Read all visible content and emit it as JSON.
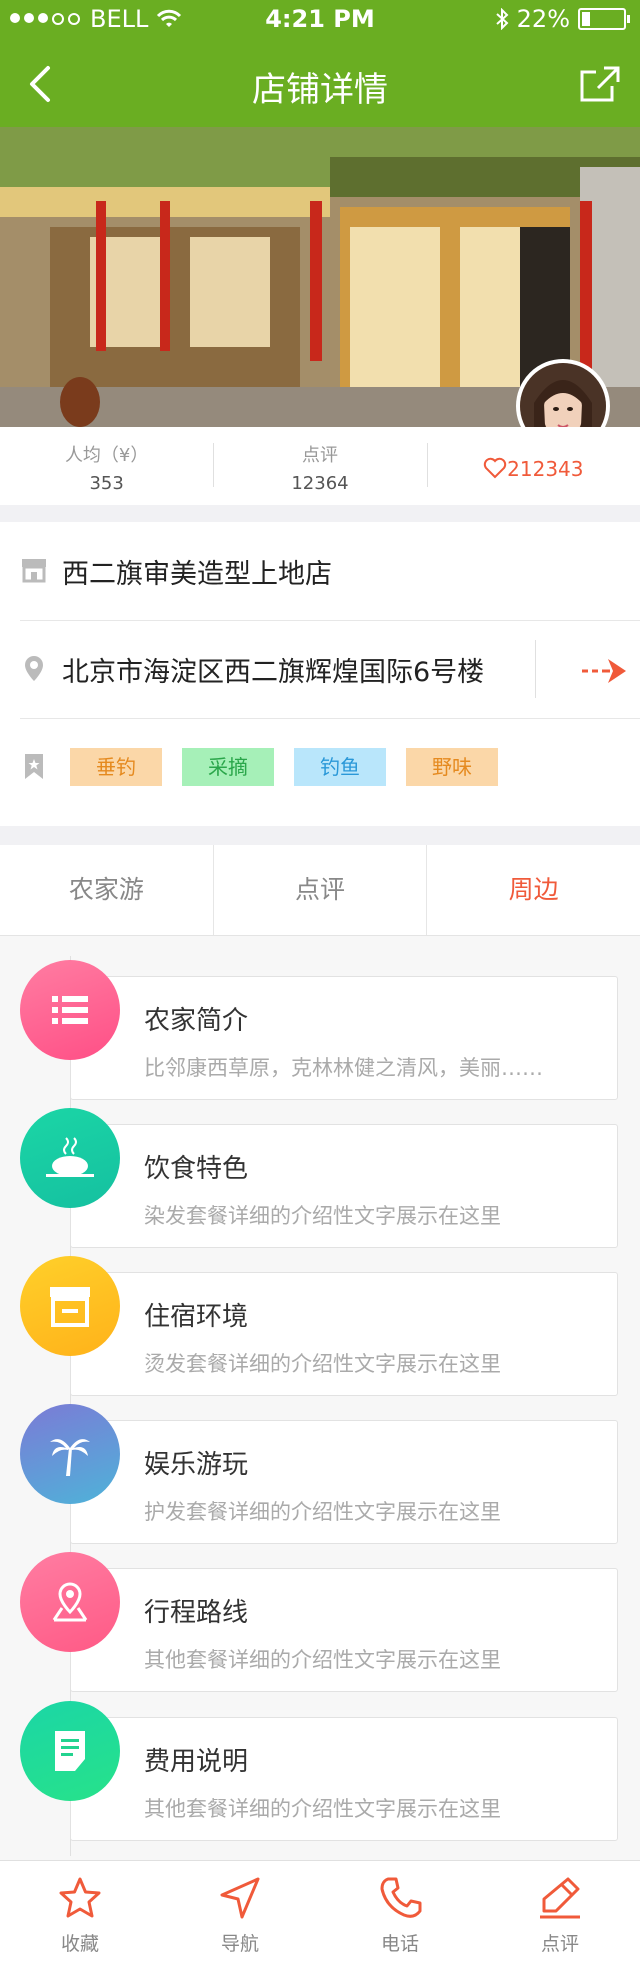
{
  "status": {
    "carrier": "BELL",
    "time": "4:21 PM",
    "battery": "22%",
    "battery_level": 0.22
  },
  "nav": {
    "title": "店铺详情"
  },
  "stats": [
    {
      "label": "人均（¥）",
      "value": "353"
    },
    {
      "label": "点评",
      "value": "12364"
    }
  ],
  "likes": "212343",
  "shop": {
    "name": "西二旗审美造型上地店",
    "address": "北京市海淀区西二旗辉煌国际6号楼",
    "tags": [
      {
        "label": "垂钓",
        "bg": "#fbd7a8",
        "color": "#e58a1f"
      },
      {
        "label": "采摘",
        "bg": "#a6f0b8",
        "color": "#2aa64a"
      },
      {
        "label": "钓鱼",
        "bg": "#b9e6fb",
        "color": "#2a98d8"
      },
      {
        "label": "野味",
        "bg": "#fbd7a8",
        "color": "#e58a1f"
      }
    ]
  },
  "tabs": [
    {
      "label": "农家游"
    },
    {
      "label": "点评"
    },
    {
      "label": "周边",
      "active": true
    }
  ],
  "items": [
    {
      "title": "农家简介",
      "desc": "比邻康西草原，克林林健之清风，美丽……",
      "icon": "list-icon",
      "colors": [
        "#ff7da2",
        "#ff4f86"
      ]
    },
    {
      "title": "饮食特色",
      "desc": "染发套餐详细的介绍性文字展示在这里",
      "icon": "food-icon",
      "colors": [
        "#1bd6a6",
        "#15c0a0"
      ]
    },
    {
      "title": "住宿环境",
      "desc": "烫发套餐详细的介绍性文字展示在这里",
      "icon": "house-icon",
      "colors": [
        "#ffd02a",
        "#ffb21a"
      ]
    },
    {
      "title": "娱乐游玩",
      "desc": "护发套餐详细的介绍性文字展示在这里",
      "icon": "palm-tree-icon",
      "colors": [
        "#7c7ad6",
        "#4eb3d9"
      ]
    },
    {
      "title": "行程路线",
      "desc": "其他套餐详细的介绍性文字展示在这里",
      "icon": "location-icon",
      "colors": [
        "#ff7da2",
        "#ff5a86"
      ]
    },
    {
      "title": "费用说明",
      "desc": "其他套餐详细的介绍性文字展示在这里",
      "icon": "document-icon",
      "colors": [
        "#1bd6a6",
        "#27e28a"
      ]
    }
  ],
  "bottom": [
    {
      "label": "收藏",
      "icon": "star-icon"
    },
    {
      "label": "导航",
      "icon": "navigation-icon"
    },
    {
      "label": "电话",
      "icon": "phone-icon"
    },
    {
      "label": "点评",
      "icon": "edit-icon"
    }
  ],
  "colors": {
    "brand": "#6aae22",
    "accent": "#f05a3a"
  }
}
